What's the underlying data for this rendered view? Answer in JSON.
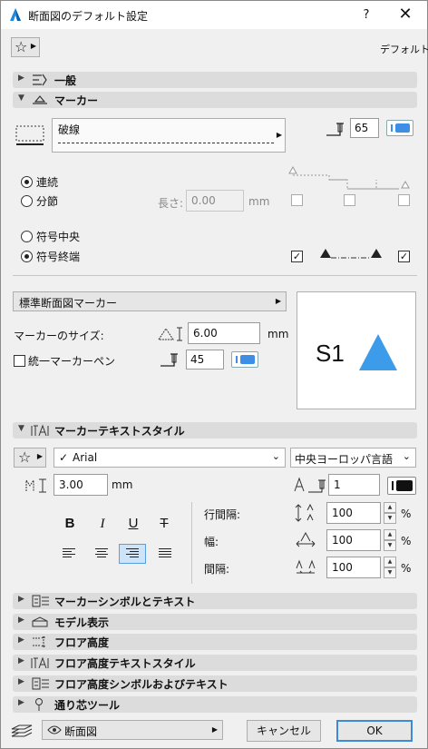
{
  "window": {
    "title": "断面図のデフォルト設定",
    "help_label": "?",
    "close_label": "✕"
  },
  "top": {
    "favorites_label": "☆",
    "preset_label": "デフォルト"
  },
  "sections": {
    "general": "一般",
    "marker": "マーカー",
    "marker_text_style": "マーカーテキストスタイル",
    "marker_symbol_text": "マーカーシンボルとテキスト",
    "model_display": "モデル表示",
    "floor_height": "フロア高度",
    "floor_height_text_style": "フロア高度テキストスタイル",
    "floor_height_symbol_text": "フロア高度シンボルおよびテキスト",
    "walkthrough_tool": "通り芯ツール"
  },
  "marker": {
    "line_type": "破線",
    "line_pen": "65",
    "continuous_label": "連続",
    "segmented_label": "分節",
    "length_label": "長さ:",
    "length_value": "0.00",
    "length_unit": "mm",
    "symbol_center_label": "符号中央",
    "symbol_end_label": "符号終端",
    "marker_type": "標準断面図マーカー",
    "marker_size_label": "マーカーのサイズ:",
    "marker_size_value": "6.00",
    "marker_size_unit": "mm",
    "unified_pen_label": "統一マーカーペン",
    "marker_pen": "45",
    "preview_text": "S1"
  },
  "text_style": {
    "font": "Arial",
    "font_check": "✓",
    "script": "中央ヨーロッパ言語",
    "size_value": "3.00",
    "size_unit": "mm",
    "text_pen": "1",
    "bold": "B",
    "italic": "I",
    "underline": "U",
    "strike": "T",
    "line_spacing_label": "行間隔:",
    "line_spacing_value": "100",
    "width_label": "幅:",
    "width_value": "100",
    "spacing_label": "間隔:",
    "spacing_value": "100",
    "percent": "%"
  },
  "footer": {
    "view_label": "断面図",
    "cancel_label": "キャンセル",
    "ok_label": "OK"
  },
  "colors": {
    "accent": "#3d8fe6",
    "preview_triangle": "#3d9ce9"
  }
}
